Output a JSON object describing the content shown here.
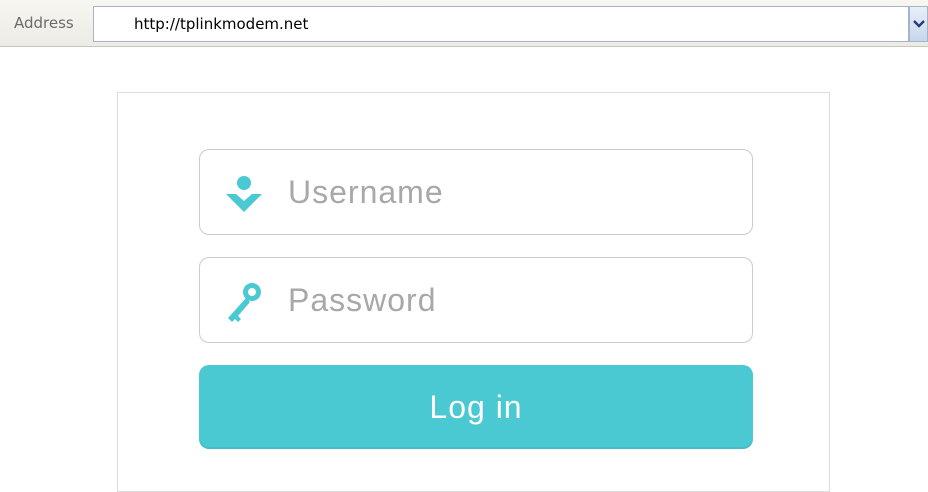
{
  "address_bar": {
    "label": "Address",
    "url": "http://tplinkmodem.net"
  },
  "login": {
    "username_placeholder": "Username",
    "password_placeholder": "Password",
    "login_label": "Log in"
  },
  "colors": {
    "accent": "#4ac9d3",
    "icon": "#4ac9d3",
    "border": "#cccccc",
    "placeholder": "#a8a8a8"
  },
  "icons": {
    "username": "user-icon",
    "password": "key-icon",
    "dropdown": "chevron-down-icon"
  }
}
